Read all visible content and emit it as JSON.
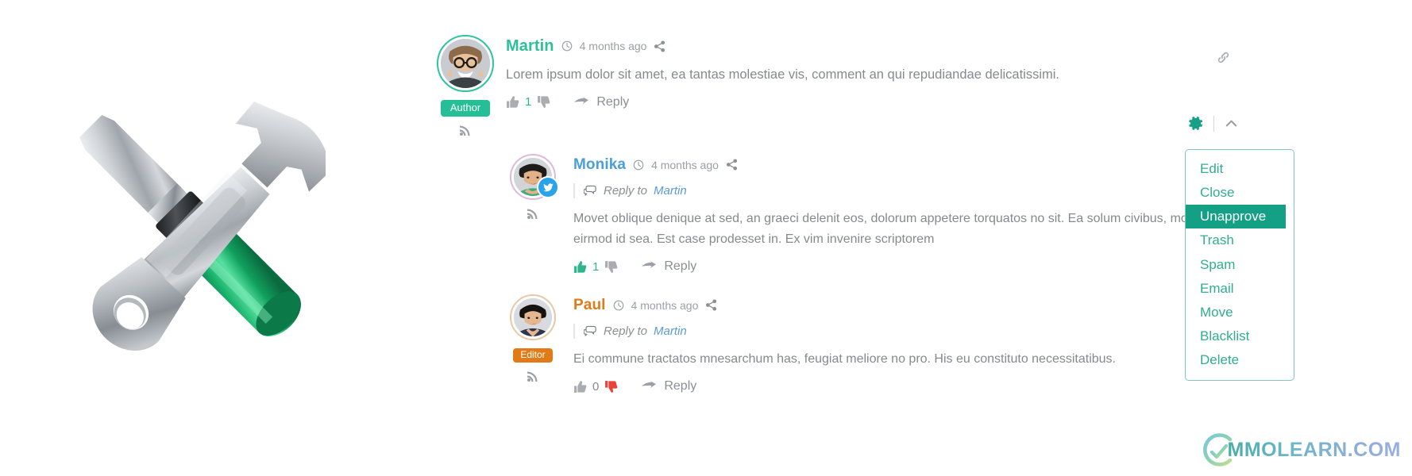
{
  "illustration": {
    "name": "wrench-and-screwdriver-illustration",
    "handle_color": "#16a05f",
    "metal_color": "#b9bec3"
  },
  "permalink": {
    "icon": "link-icon"
  },
  "moderation": {
    "gear_icon": "gear-icon",
    "collapse_icon": "chevron-up-icon",
    "menu": {
      "selected": "Unapprove",
      "accent": "#14a085",
      "items": [
        {
          "label": "Edit"
        },
        {
          "label": "Close"
        },
        {
          "label": "Unapprove"
        },
        {
          "label": "Trash"
        },
        {
          "label": "Spam"
        },
        {
          "label": "Email"
        },
        {
          "label": "Move"
        },
        {
          "label": "Blacklist"
        },
        {
          "label": "Delete"
        }
      ]
    }
  },
  "comments": [
    {
      "author": "Martin",
      "author_color": "#2ebf9c",
      "timestamp": "4 months ago",
      "role_badge": "Author",
      "role_badge_color": "#25bf97",
      "text": "Lorem ipsum dolor sit amet, ea tantas molestiae vis, comment an qui repudiandae delicatissimi.",
      "vote_count": "1",
      "thumb_up_active": false,
      "thumb_down_active": false,
      "reply_label": "Reply",
      "social_badge": null,
      "reply_to": null,
      "reply_to_prefix": null
    },
    {
      "author": "Monika",
      "author_color": "#4a9fd8",
      "timestamp": "4 months ago",
      "role_badge": null,
      "role_badge_color": null,
      "text": "Movet oblique denique at sed, an graeci delenit eos, dolorum appetere torquatos no sit. Ea solum civibus, movet tation eirmod id sea. Est case prodesset in. Ex vim invenire scriptorem",
      "vote_count": "1",
      "thumb_up_active": true,
      "thumb_down_active": false,
      "reply_label": "Reply",
      "social_badge": "twitter-icon",
      "reply_to": "Martin",
      "reply_to_prefix": "Reply to"
    },
    {
      "author": "Paul",
      "author_color": "#e07b18",
      "timestamp": "4 months ago",
      "role_badge": "Editor",
      "role_badge_color": "#e07b18",
      "text": "Ei commune tractatos mnesarchum has, feugiat meliore no pro. His eu constituto necessitatibus.",
      "vote_count": "0",
      "thumb_up_active": false,
      "thumb_down_active": true,
      "reply_label": "Reply",
      "social_badge": null,
      "reply_to": "Martin",
      "reply_to_prefix": "Reply to"
    }
  ],
  "watermark": {
    "text": "MMOLEARN.COM"
  }
}
